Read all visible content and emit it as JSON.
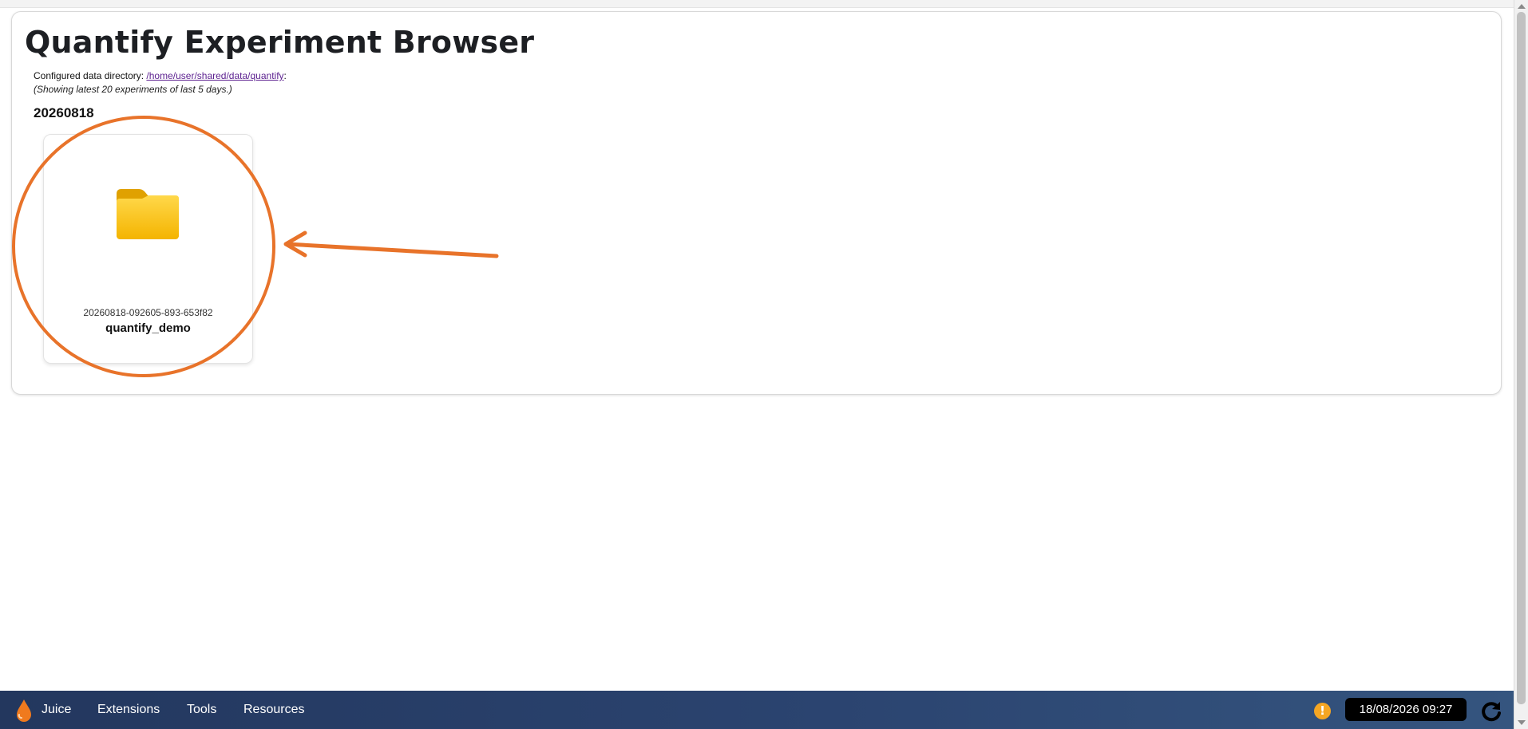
{
  "page": {
    "title": "Quantify Experiment Browser",
    "config_prefix": "Configured data directory: ",
    "config_path": "/home/user/shared/data/quantify",
    "config_suffix": ":",
    "showing_note": "(Showing latest 20 experiments of last 5 days.)"
  },
  "groups": [
    {
      "date": "20260818",
      "experiments": [
        {
          "id": "20260818-092605-893-653f82",
          "name": "quantify_demo",
          "icon": "folder-icon"
        }
      ]
    }
  ],
  "annotation": {
    "color": "#E8732A",
    "shapes": [
      "circle",
      "arrow"
    ]
  },
  "taskbar": {
    "logo_icon": "juice-drop-icon",
    "items": [
      "Juice",
      "Extensions",
      "Tools",
      "Resources"
    ],
    "warning_icon": "!",
    "clock": "18/08/2026 09:27",
    "refresh_icon": "refresh-icon"
  },
  "colors": {
    "accent": "#E8732A",
    "link": "#5B1F8F",
    "taskbar": "#2B4470",
    "folder": "#F5C518"
  }
}
